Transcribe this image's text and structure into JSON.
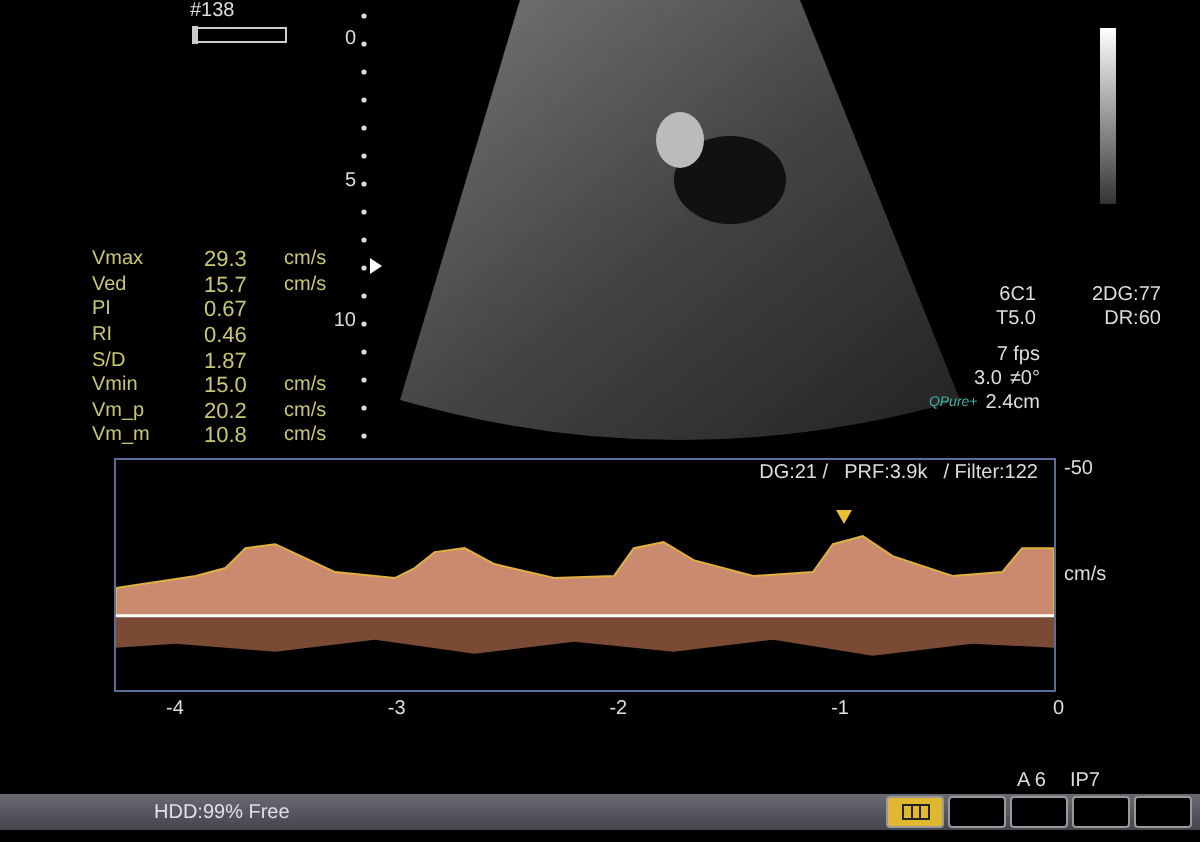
{
  "frame": {
    "number": "#138"
  },
  "depth_scale": [
    "0",
    "5",
    "10"
  ],
  "measurements": [
    {
      "name": "Vmax",
      "value": "29.3",
      "unit": "cm/s"
    },
    {
      "name": "Ved",
      "value": "15.7",
      "unit": "cm/s"
    },
    {
      "name": "PI",
      "value": "0.67"
    },
    {
      "name": "RI",
      "value": "0.46"
    },
    {
      "name": "S/D",
      "value": "1.87"
    },
    {
      "name": "Vmin",
      "value": "15.0",
      "unit": "cm/s"
    },
    {
      "name": "Vm_p",
      "value": "20.2",
      "unit": "cm/s"
    },
    {
      "name": "Vm_m",
      "value": "10.8",
      "unit": "cm/s"
    }
  ],
  "probe_info": [
    "6C1",
    "T5.0"
  ],
  "frame_rate": "7 fps",
  "doppler_angle": {
    "scale": "3.0",
    "angle": "≠0°"
  },
  "logo": "QPure+",
  "gate_size": "2.4cm",
  "gain_info": [
    "2DG:77",
    "DR:60"
  ],
  "doppler": {
    "settings": [
      "DG:21 /",
      "PRF:3.9k",
      "/ Filter:122"
    ],
    "velocity_label": "-50",
    "unit": "cm/s",
    "time_axis": [
      "-4",
      "-3",
      "-2",
      "-1",
      "0"
    ]
  },
  "slot_labels": [
    "A 6",
    "IP7"
  ],
  "status_bar": {
    "text": "HDD:99% Free",
    "slots": [
      {
        "selected": true
      },
      {
        "selected": false
      },
      {
        "selected": false
      },
      {
        "selected": false
      },
      {
        "selected": false
      }
    ]
  }
}
